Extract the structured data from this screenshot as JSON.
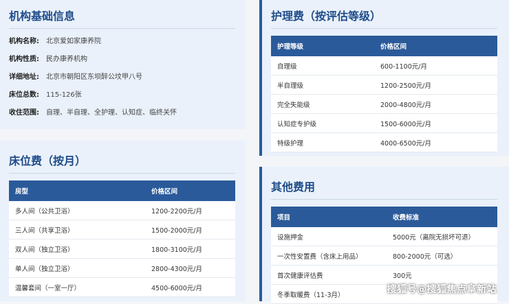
{
  "basic": {
    "title": "机构基础信息",
    "rows": [
      {
        "label": "机构名称:",
        "value": "北京爱如家康养院"
      },
      {
        "label": "机构性质:",
        "value": "民办康养机构"
      },
      {
        "label": "详细地址:",
        "value": "北京市朝阳区东坝醉公坟甲八号"
      },
      {
        "label": "床位总数:",
        "value": "115-126张"
      },
      {
        "label": "收住范围:",
        "value": "自理、半自理、全护理、认知症、临终关怀"
      }
    ]
  },
  "bed": {
    "title": "床位费（按月）",
    "headers": [
      "房型",
      "价格区间"
    ],
    "rows": [
      [
        "多人间（公共卫浴）",
        "1200-2200元/月"
      ],
      [
        "三人间（共享卫浴）",
        "1500-2000元/月"
      ],
      [
        "双人间（独立卫浴）",
        "1800-3100元/月"
      ],
      [
        "单人间（独立卫浴）",
        "2800-4300元/月"
      ],
      [
        "温馨套间（一室一厅）",
        "4500-6000元/月"
      ]
    ]
  },
  "care": {
    "title": "护理费（按评估等级）",
    "headers": [
      "护理等级",
      "价格区间"
    ],
    "rows": [
      [
        "自理级",
        "600-1100元/月"
      ],
      [
        "半自理级",
        "1200-2500元/月"
      ],
      [
        "完全失能级",
        "2000-4800元/月"
      ],
      [
        "认知症专护级",
        "1500-6000元/月"
      ],
      [
        "特级护理",
        "4000-6500元/月"
      ]
    ]
  },
  "other": {
    "title": "其他费用",
    "headers": [
      "项目",
      "收费标准"
    ],
    "rows": [
      [
        "设施押金",
        "5000元（离院无损坏可退）"
      ],
      [
        "一次性安置费（含床上用品）",
        "800-2000元（可选）"
      ],
      [
        "首次健康评估费",
        "300元"
      ],
      [
        "冬季取暖费（11-3月）",
        ""
      ]
    ]
  },
  "watermark": "搜狐号@搜狐焦点阜新站"
}
